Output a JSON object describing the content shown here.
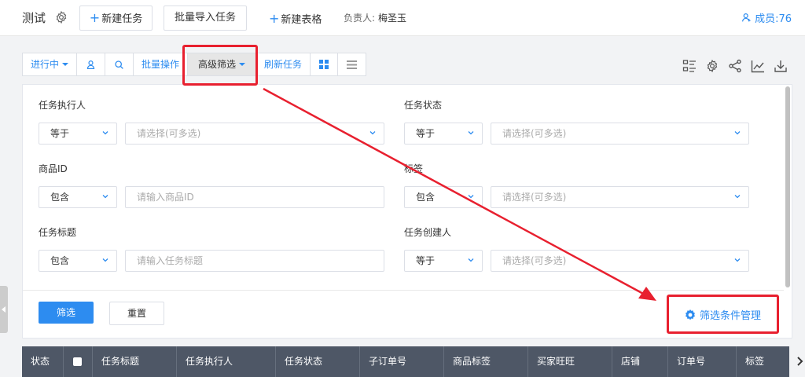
{
  "header": {
    "title": "测试",
    "new_task_label": "新建任务",
    "batch_import_label": "批量导入任务",
    "new_table_label": "新建表格",
    "owner_label": "负责人:",
    "owner_name": "梅圣玉",
    "members_label": "成员:76",
    "plus_glyph": "+"
  },
  "toolbar": {
    "status_label": "进行中",
    "batch_label": "批量操作",
    "advanced_filter_label": "高级筛选",
    "refresh_label": "刷新任务"
  },
  "filters": {
    "assignee": {
      "label": "任务执行人",
      "op": "等于",
      "placeholder": "请选择(可多选)"
    },
    "status": {
      "label": "任务状态",
      "op": "等于",
      "placeholder": "请选择(可多选)"
    },
    "product_id": {
      "label": "商品ID",
      "op": "包含",
      "placeholder": "请输入商品ID"
    },
    "tag": {
      "label": "标签",
      "op": "包含",
      "placeholder": "请选择(可多选)"
    },
    "task_title": {
      "label": "任务标题",
      "op": "包含",
      "placeholder": "请输入任务标题"
    },
    "creator": {
      "label": "任务创建人",
      "op": "等于",
      "placeholder": "请选择(可多选)"
    },
    "submit_label": "筛选",
    "reset_label": "重置",
    "manage_label": "筛选条件管理"
  },
  "table": {
    "columns": [
      "状态",
      "任务标题",
      "任务执行人",
      "任务状态",
      "子订单号",
      "商品标签",
      "买家旺旺",
      "店铺",
      "订单号",
      "标签"
    ]
  },
  "colors": {
    "accent": "#2d8cf0",
    "highlight": "#e8202f",
    "table_header": "#4e5766"
  }
}
